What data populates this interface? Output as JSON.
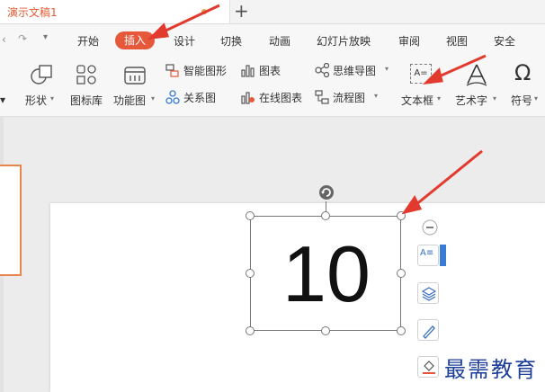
{
  "doc_tab": {
    "title": "演示文稿1",
    "new_tab": "+"
  },
  "menu": {
    "items": [
      "开始",
      "插入",
      "设计",
      "切换",
      "动画",
      "幻灯片放映",
      "审阅",
      "视图",
      "安全"
    ],
    "active": "插入",
    "active_color": "#e5583a"
  },
  "ribbon": {
    "shapes": "形状",
    "icon_library": "图标库",
    "function_chart": "功能图",
    "smart_art": "智能图形",
    "chart": "图表",
    "relation_chart": "关系图",
    "online_chart": "在线图表",
    "mind_map": "思维导图",
    "flowchart": "流程图",
    "textbox": "文本框",
    "word_art": "艺术字",
    "symbol": "符号",
    "textbox_icon_glyph": "A="
  },
  "slide": {
    "textbox_text": "10"
  },
  "watermark": "最需教育",
  "colors": {
    "accent": "#e5583a",
    "arrow": "#e23a2e",
    "watermark": "#1d3f9a"
  }
}
